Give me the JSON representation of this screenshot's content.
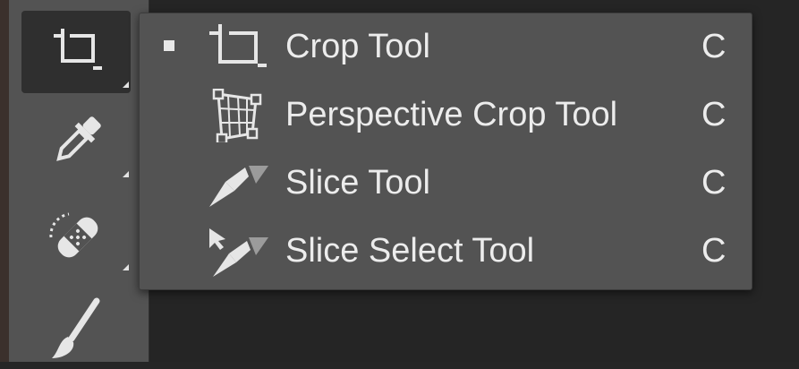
{
  "toolbar": {
    "tools": [
      {
        "name": "crop-tool",
        "icon": "crop-icon",
        "active": true
      },
      {
        "name": "eyedropper-tool",
        "icon": "eyedropper-icon",
        "active": false
      },
      {
        "name": "healing-brush-tool",
        "icon": "bandage-icon",
        "active": false
      },
      {
        "name": "brush-tool",
        "icon": "brush-icon",
        "active": false
      }
    ]
  },
  "flyout": {
    "items": [
      {
        "label": "Crop Tool",
        "shortcut": "C",
        "icon": "crop-icon",
        "selected": true
      },
      {
        "label": "Perspective Crop Tool",
        "shortcut": "C",
        "icon": "perspective-crop-icon",
        "selected": false
      },
      {
        "label": "Slice Tool",
        "shortcut": "C",
        "icon": "slice-icon",
        "selected": false
      },
      {
        "label": "Slice Select Tool",
        "shortcut": "C",
        "icon": "slice-select-icon",
        "selected": false
      }
    ]
  },
  "colors": {
    "panel": "#535353",
    "active_slot": "#2f2f2f",
    "text": "#ececec",
    "background": "#252525"
  }
}
